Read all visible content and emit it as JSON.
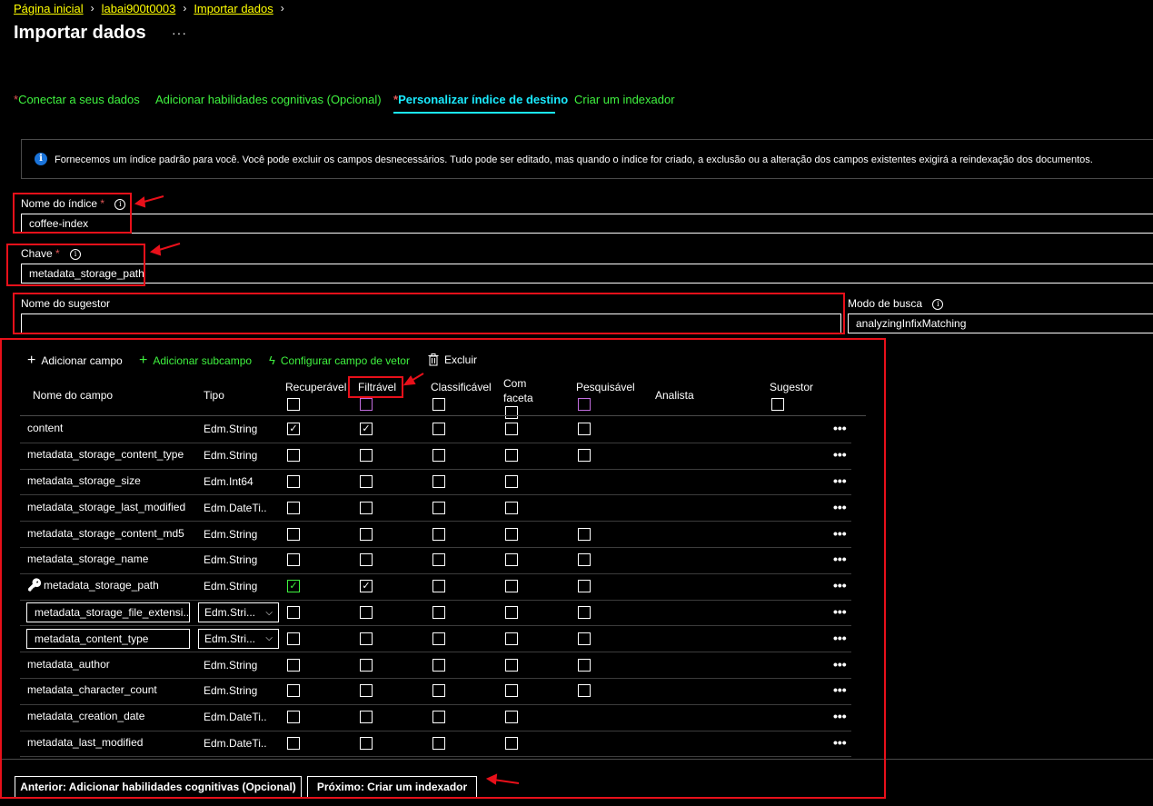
{
  "breadcrumb": [
    "Página inicial",
    "labai900t0003",
    "Importar dados"
  ],
  "page_title": "Importar dados",
  "title_more": "···",
  "tabs": [
    {
      "label": "Conectar a seus dados",
      "required": true
    },
    {
      "label": "Adicionar habilidades cognitivas (Opcional)",
      "required": false
    },
    {
      "label": "Personalizar índice de destino",
      "required": true
    },
    {
      "label": "Criar um indexador",
      "required": false
    }
  ],
  "active_tab": "Personalizar índice de destino",
  "info": {
    "icon": "i",
    "text": "Fornecemos um índice padrão para você. Você pode excluir os campos desnecessários. Tudo pode ser editado, mas quando o índice for criado, a exclusão ou a alteração dos campos existentes exigirá a reindexação dos documentos."
  },
  "index_name": {
    "label": "Nome do índice",
    "required_mark": "*",
    "value": "coffee-index"
  },
  "key": {
    "label": "Chave",
    "required_mark": "*",
    "value": "metadata_storage_path"
  },
  "suggester": {
    "label": "Nome do sugestor",
    "value": ""
  },
  "search_mode": {
    "label": "Modo de busca",
    "value": "analyzingInfixMatching"
  },
  "toolbar": {
    "add_field": "Adicionar campo",
    "add_subfield": "Adicionar subcampo",
    "configure_vector": "Configurar campo de vetor",
    "delete": "Excluir"
  },
  "columns": {
    "name": "Nome do campo",
    "type": "Tipo",
    "retrievable": "Recuperável",
    "filterable": "Filtrável",
    "sortable": "Classificável",
    "facetable_1": "Com",
    "facetable_2": "faceta",
    "searchable": "Pesquisável",
    "analyzer": "Analista",
    "suggester": "Sugestor"
  },
  "rows": [
    {
      "name": "content",
      "type": "Edm.String",
      "retrievable": true,
      "filterable": true,
      "sortable": false,
      "facetable": false,
      "searchable": false,
      "has_searchable": true
    },
    {
      "name": "metadata_storage_content_type",
      "type": "Edm.String",
      "retrievable": false,
      "filterable": false,
      "sortable": false,
      "facetable": false,
      "searchable": false,
      "has_searchable": true
    },
    {
      "name": "metadata_storage_size",
      "type": "Edm.Int64",
      "retrievable": false,
      "filterable": false,
      "sortable": false,
      "facetable": false,
      "has_searchable": false
    },
    {
      "name": "metadata_storage_last_modified",
      "type": "Edm.DateTi...",
      "retrievable": false,
      "filterable": false,
      "sortable": false,
      "facetable": false,
      "has_searchable": false
    },
    {
      "name": "metadata_storage_content_md5",
      "type": "Edm.String",
      "retrievable": false,
      "filterable": false,
      "sortable": false,
      "facetable": false,
      "searchable": false,
      "has_searchable": true
    },
    {
      "name": "metadata_storage_name",
      "type": "Edm.String",
      "retrievable": false,
      "filterable": false,
      "sortable": false,
      "facetable": false,
      "searchable": false,
      "has_searchable": true
    },
    {
      "name": "metadata_storage_path",
      "type": "Edm.String",
      "key": true,
      "retrievable": true,
      "filterable": true,
      "sortable": false,
      "facetable": false,
      "searchable": false,
      "has_searchable": true
    },
    {
      "name": "metadata_storage_file_extensi...",
      "type": "Edm.Stri...",
      "editable": true,
      "retrievable": false,
      "filterable": false,
      "sortable": false,
      "facetable": false,
      "searchable": false,
      "has_searchable": true
    },
    {
      "name": "metadata_content_type",
      "type": "Edm.Stri...",
      "editable": true,
      "retrievable": false,
      "filterable": false,
      "sortable": false,
      "facetable": false,
      "searchable": false,
      "has_searchable": true
    },
    {
      "name": "metadata_author",
      "type": "Edm.String",
      "retrievable": false,
      "filterable": false,
      "sortable": false,
      "facetable": false,
      "searchable": false,
      "has_searchable": true
    },
    {
      "name": "metadata_character_count",
      "type": "Edm.String",
      "retrievable": false,
      "filterable": false,
      "sortable": false,
      "facetable": false,
      "searchable": false,
      "has_searchable": true
    },
    {
      "name": "metadata_creation_date",
      "type": "Edm.DateTi...",
      "retrievable": false,
      "filterable": false,
      "sortable": false,
      "facetable": false,
      "has_searchable": false
    },
    {
      "name": "metadata_last_modified",
      "type": "Edm.DateTi...",
      "retrievable": false,
      "filterable": false,
      "sortable": false,
      "facetable": false,
      "has_searchable": false
    }
  ],
  "row_more": "•••",
  "footer": {
    "prev": "Anterior: Adicionar habilidades cognitivas (Opcional)",
    "next": "Próximo: Criar um indexador"
  },
  "colors": {
    "accent_active": "#1aebff",
    "link_green": "#3ff23f",
    "breadcrumb": "#ffff00",
    "annotation_red": "#e8101a",
    "info_blue": "#1a73d9"
  }
}
